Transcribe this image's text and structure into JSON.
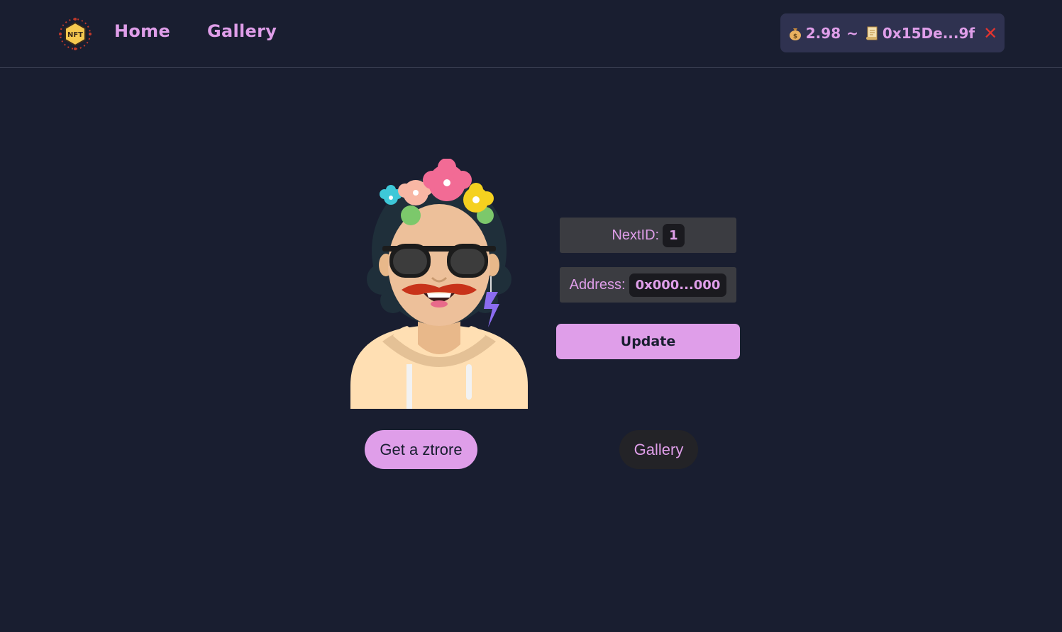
{
  "nav": {
    "logo_icon": "nft-badge-icon",
    "links": [
      "Home",
      "Gallery"
    ]
  },
  "wallet": {
    "balance_icon": "money-bag-icon",
    "balance": "2.98",
    "separator": "~",
    "address_icon": "scroll-icon",
    "address": "0x15De...9f",
    "disconnect_icon": "close-x-icon",
    "disconnect_glyph": "✕"
  },
  "contract": {
    "next_id_label": "NextID:",
    "next_id_value": "1",
    "address_label": "Address:",
    "address_value": "0x000...000",
    "update_label": "Update"
  },
  "actions": {
    "get_label": "Get a ztrore",
    "gallery_label": "Gallery"
  },
  "colors": {
    "background": "#191e30",
    "accent": "#df9ee9",
    "panel": "#3b3c41",
    "wallet_bg": "#2f3250",
    "close": "#e3342f"
  }
}
